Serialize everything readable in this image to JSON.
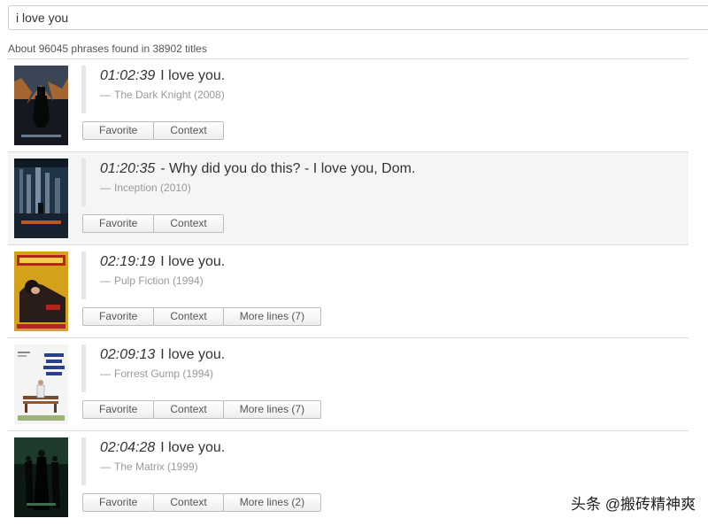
{
  "search": {
    "value": "i love you"
  },
  "summary": "About 96045 phrases found in 38902 titles",
  "labels": {
    "favorite": "Favorite",
    "context": "Context"
  },
  "results": [
    {
      "time": "01:02:39",
      "text": "I love you.",
      "dash": "—",
      "source": "The Dark Knight (2008)",
      "more": "",
      "poster_text": "",
      "colors": {
        "bg": "#15191f",
        "accent": "#b86b2a"
      }
    },
    {
      "time": "01:20:35",
      "text": "- Why did you do this? - I love you, Dom.",
      "dash": "—",
      "source": "Inception (2010)",
      "more": "",
      "poster_text": "INCEPTION",
      "colors": {
        "bg": "#1f3446",
        "accent": "#c0552d"
      }
    },
    {
      "time": "02:19:19",
      "text": "I love you.",
      "dash": "—",
      "source": "Pulp Fiction (1994)",
      "more": "More lines (7)",
      "poster_text": "PULP FICTION",
      "colors": {
        "bg": "#d6a11a",
        "accent": "#b3241c"
      }
    },
    {
      "time": "02:09:13",
      "text": "I love you.",
      "dash": "—",
      "source": "Forrest Gump (1994)",
      "more": "More lines (7)",
      "poster_text": "Tom Hanks is Forrest Gump",
      "colors": {
        "bg": "#f4f4f4",
        "accent": "#2b3f8f"
      }
    },
    {
      "time": "02:04:28",
      "text": "I love you.",
      "dash": "—",
      "source": "The Matrix (1999)",
      "more": "More lines (2)",
      "poster_text": "MATRIX",
      "colors": {
        "bg": "#0d1a14",
        "accent": "#3d6b4e"
      }
    }
  ],
  "watermark": "头条 @搬砖精神爽"
}
